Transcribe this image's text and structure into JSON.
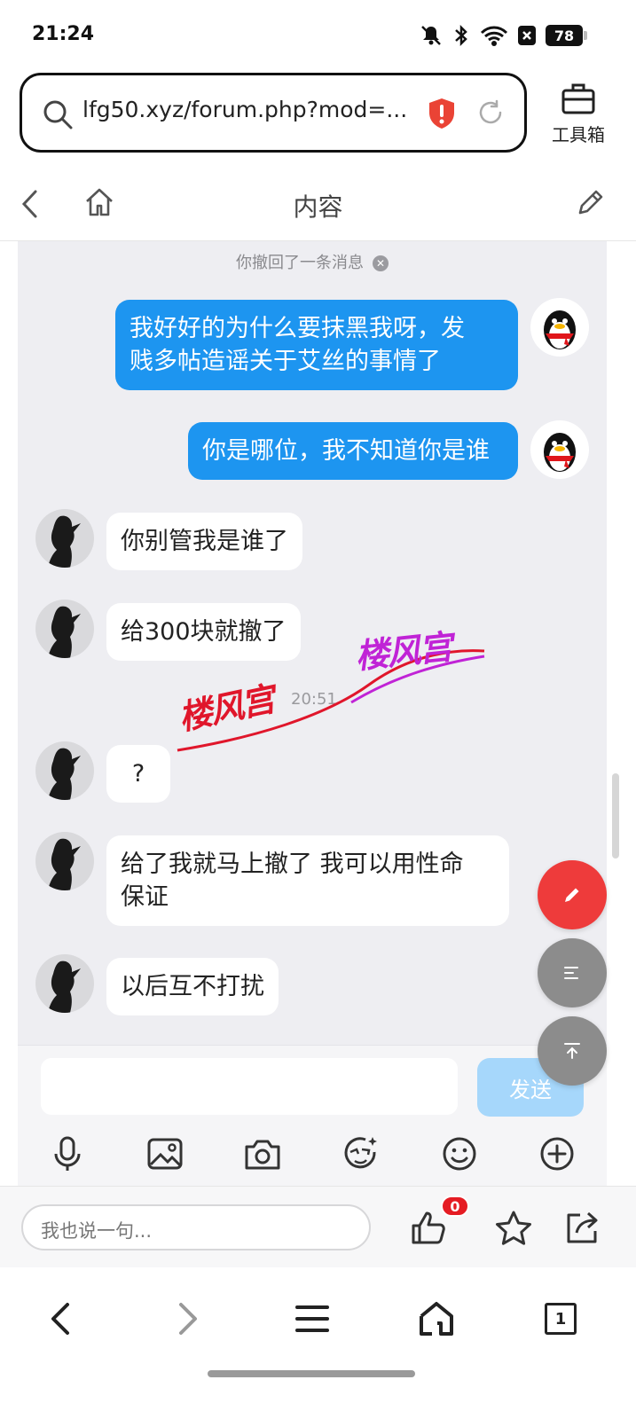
{
  "status_bar": {
    "time": "21:24",
    "battery": "78"
  },
  "url_bar": {
    "url": "lfg50.xyz/forum.php?mod=..."
  },
  "toolbox": {
    "label": "工具箱"
  },
  "header": {
    "title": "内容"
  },
  "chat": {
    "recall_note": "你撤回了一条消息",
    "messages": [
      {
        "direction": "out",
        "text_line1": "我好好的为什么要抹黑我呀，发",
        "text_line2": "贱多帖造谣关于艾丝的事情了"
      },
      {
        "direction": "out",
        "text_line1": "你是哪位，我不知道你是谁"
      },
      {
        "direction": "in",
        "text_line1": "你别管我是谁了"
      },
      {
        "direction": "in",
        "text_line1": "给300块就撤了"
      },
      {
        "direction": "in",
        "text_line1": "?"
      },
      {
        "direction": "in",
        "text_line1": "给了我就马上撤了 我可以用性命",
        "text_line2": "保证"
      },
      {
        "direction": "in",
        "text_line1": "以后互不打扰"
      }
    ],
    "timestamp": "20:51",
    "watermark": "楼风宫",
    "send_label": "发送"
  },
  "comment_bar": {
    "placeholder": "我也说一句...",
    "like_count": "0"
  },
  "bottom_nav": {
    "tab_count": "1"
  },
  "colors": {
    "outgoing_bubble": "#1d95f0",
    "fab_edit": "#ee3b3b",
    "badge": "#e51c23"
  }
}
